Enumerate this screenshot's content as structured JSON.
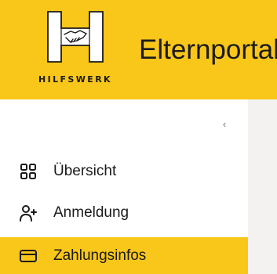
{
  "brand": {
    "logo_text": "HILFSWERK",
    "app_title": "Elternportal",
    "accent_color": "#f9c61a"
  },
  "sidebar": {
    "collapse_glyph": "‹",
    "items": [
      {
        "label": "Übersicht",
        "icon": "dashboard-grid-icon",
        "active": false
      },
      {
        "label": "Anmeldung",
        "icon": "person-add-icon",
        "active": false
      },
      {
        "label": "Zahlungsinfos",
        "icon": "credit-card-icon",
        "active": true
      }
    ]
  }
}
